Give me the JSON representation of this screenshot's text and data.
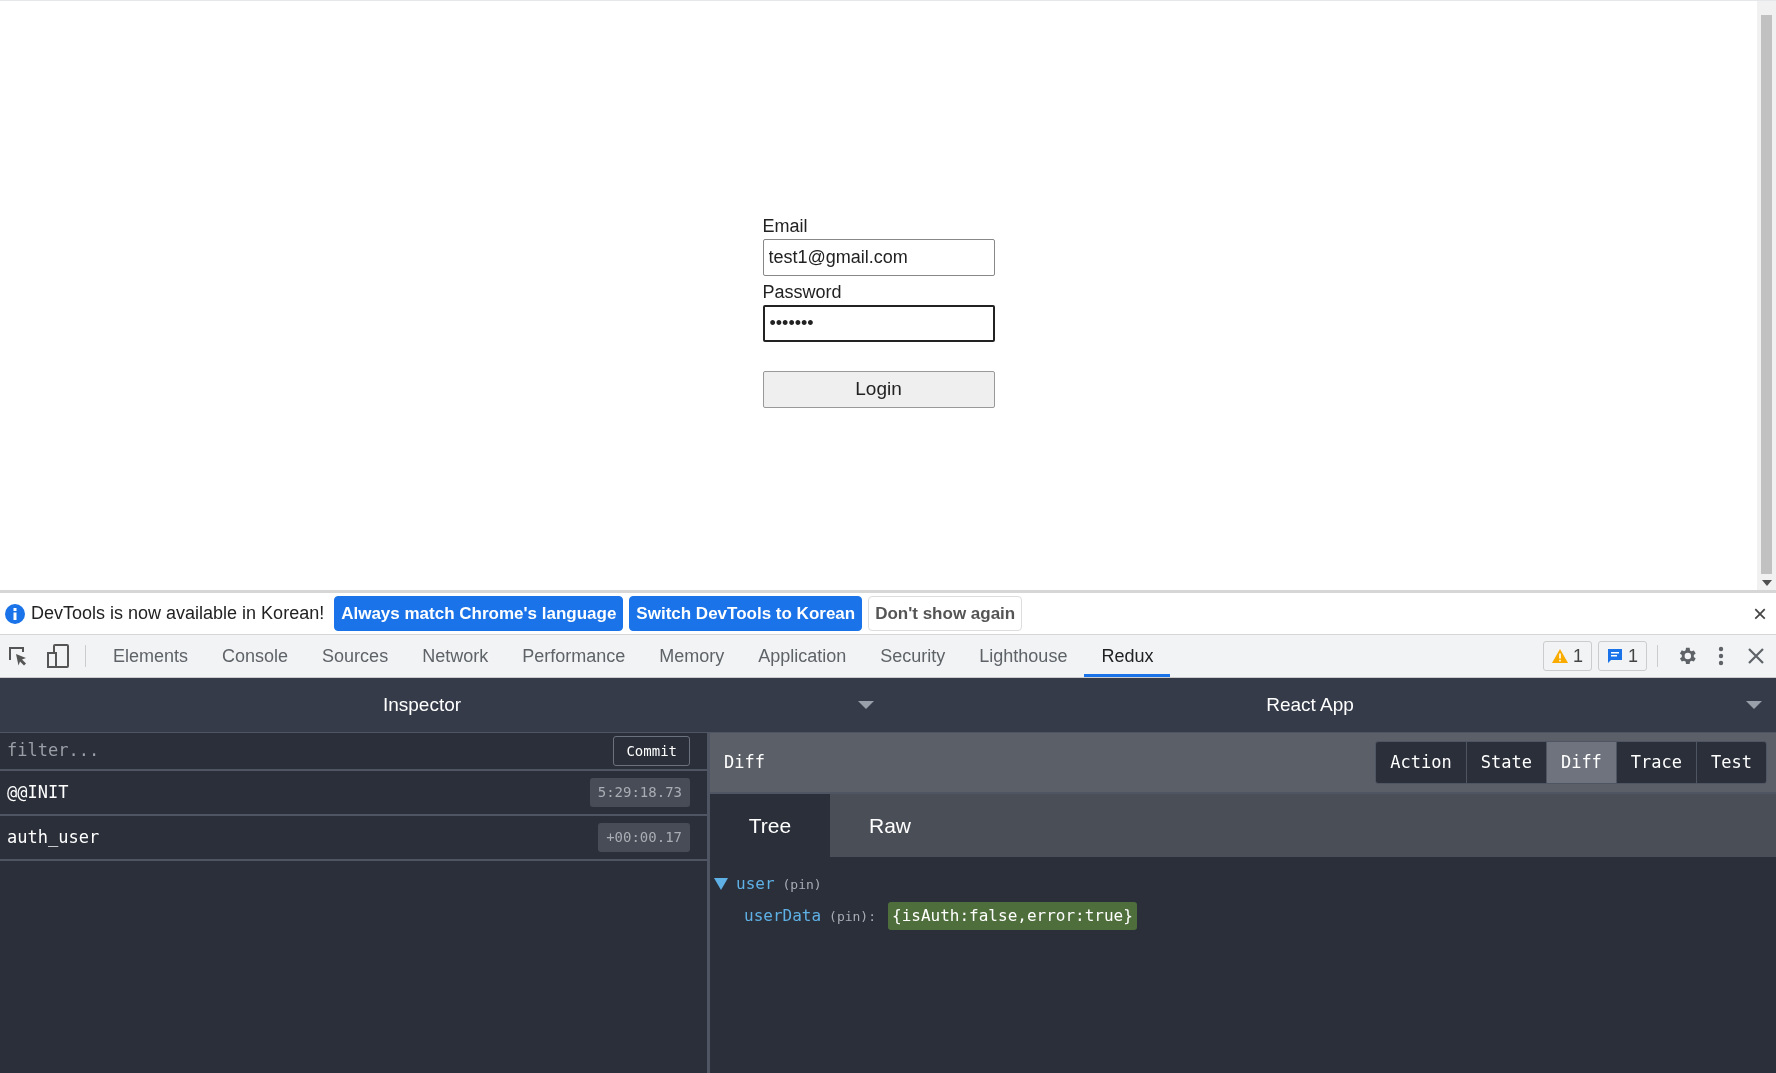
{
  "login_form": {
    "email_label": "Email",
    "email_value": "test1@gmail.com",
    "password_label": "Password",
    "password_value": "•••••••",
    "button": "Login"
  },
  "infobar": {
    "message": "DevTools is now available in Korean!",
    "buttons": [
      {
        "label": "Always match Chrome's language",
        "kind": "primary"
      },
      {
        "label": "Switch DevTools to Korean",
        "kind": "primary"
      },
      {
        "label": "Don't show again",
        "kind": "secondary"
      }
    ],
    "close": "×"
  },
  "devtools_tabs": [
    {
      "label": "Elements",
      "selected": false
    },
    {
      "label": "Console",
      "selected": false
    },
    {
      "label": "Sources",
      "selected": false
    },
    {
      "label": "Network",
      "selected": false
    },
    {
      "label": "Performance",
      "selected": false
    },
    {
      "label": "Memory",
      "selected": false
    },
    {
      "label": "Application",
      "selected": false
    },
    {
      "label": "Security",
      "selected": false
    },
    {
      "label": "Lighthouse",
      "selected": false
    },
    {
      "label": "Redux",
      "selected": true
    }
  ],
  "issue_counts": {
    "warnings": "1",
    "messages": "1"
  },
  "redux": {
    "left_title": "Inspector",
    "right_title": "React App",
    "filter": {
      "placeholder": "filter..."
    },
    "commit_button": "Commit",
    "actions": [
      {
        "name": "@@INIT",
        "time": "5:29:18.73"
      },
      {
        "name": "auth_user",
        "time": "+00:00.17"
      }
    ],
    "panel_title": "Diff",
    "view_tabs": [
      {
        "label": "Action",
        "selected": false
      },
      {
        "label": "State",
        "selected": false
      },
      {
        "label": "Diff",
        "selected": true
      },
      {
        "label": "Trace",
        "selected": false
      },
      {
        "label": "Test",
        "selected": false
      }
    ],
    "format_tabs": [
      {
        "label": "Tree",
        "selected": true
      },
      {
        "label": "Raw",
        "selected": false
      }
    ],
    "tree": [
      {
        "key": "user",
        "pin": "(pin)",
        "expanded": true,
        "children": [
          {
            "key": "userData",
            "pin": "(pin):",
            "value": "{isAuth:false,error:true}"
          }
        ]
      }
    ]
  }
}
